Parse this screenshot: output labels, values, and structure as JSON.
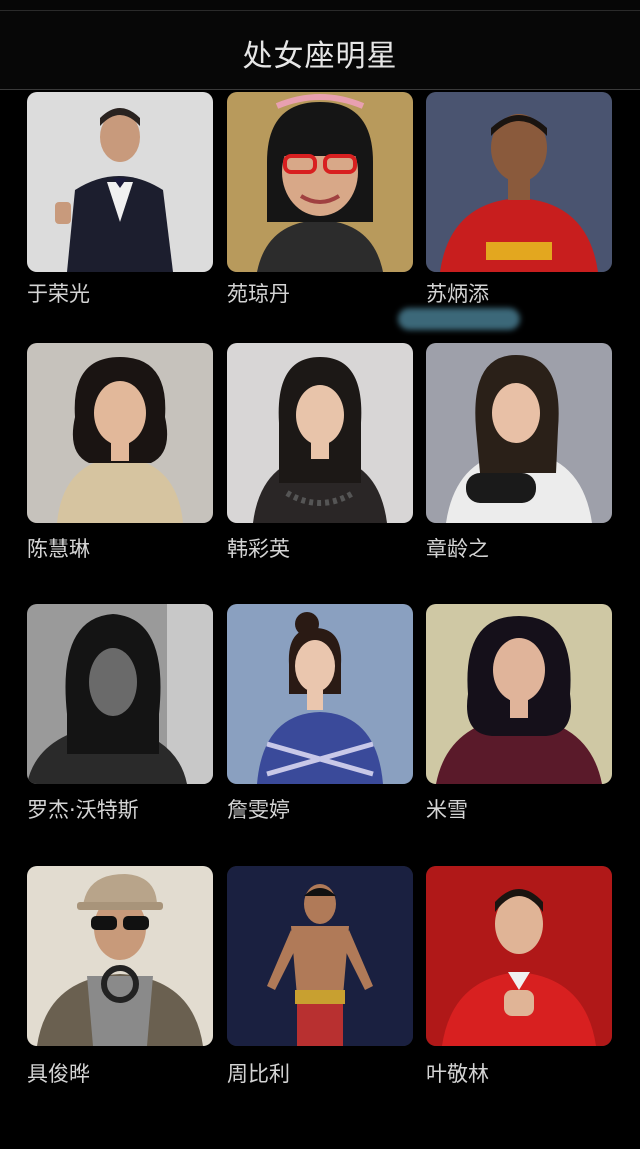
{
  "header": {
    "title": "处女座明星"
  },
  "celebrities": [
    {
      "name": "于荣光",
      "photo": "man-in-suit-thumbs-up"
    },
    {
      "name": "苑琼丹",
      "photo": "woman-red-glasses"
    },
    {
      "name": "苏炳添",
      "photo": "sprinter-red-jersey"
    },
    {
      "name": "陈慧琳",
      "photo": "woman-curly-hair"
    },
    {
      "name": "韩彩英",
      "photo": "woman-lace-dress"
    },
    {
      "name": "章龄之",
      "photo": "woman-white-shirt"
    },
    {
      "name": "罗杰·沃特斯",
      "photo": "man-long-hair-bw"
    },
    {
      "name": "詹雯婷",
      "photo": "woman-blue-knit"
    },
    {
      "name": "米雪",
      "photo": "woman-burgundy-top"
    },
    {
      "name": "具俊晔",
      "photo": "man-cap-sunglasses"
    },
    {
      "name": "周比利",
      "photo": "boxer-with-belt"
    },
    {
      "name": "叶敬林",
      "photo": "man-red-suit"
    }
  ]
}
